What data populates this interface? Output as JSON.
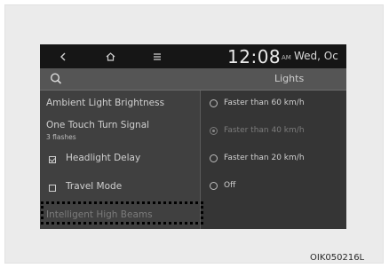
{
  "status_bar": {
    "time": "12:08",
    "ampm": "AM",
    "date": "Wed, Oc",
    "icons": [
      "back-icon",
      "home-icon",
      "menu-icon"
    ]
  },
  "header": {
    "title": "Lights",
    "search_icon": "search-icon"
  },
  "menu": {
    "ambient": "Ambient Light Brightness",
    "turn_signal": "One Touch Turn Signal",
    "turn_signal_value": "3 flashes",
    "headlight_delay": "Headlight Delay",
    "headlight_delay_checked": true,
    "travel_mode": "Travel Mode",
    "travel_mode_checked": false,
    "high_beams": "Intelligent High Beams"
  },
  "options": [
    {
      "label": "Faster than 60 km/h",
      "selected": false,
      "enabled": true
    },
    {
      "label": "Faster than 40 km/h",
      "selected": true,
      "enabled": false
    },
    {
      "label": "Faster than 20 km/h",
      "selected": false,
      "enabled": true
    },
    {
      "label": "Off",
      "selected": false,
      "enabled": true
    }
  ],
  "figure_code": "OIK050216L",
  "colors": {
    "background": "#ebebeb",
    "screen": "#3a3a3a",
    "status_bar": "#161616"
  }
}
